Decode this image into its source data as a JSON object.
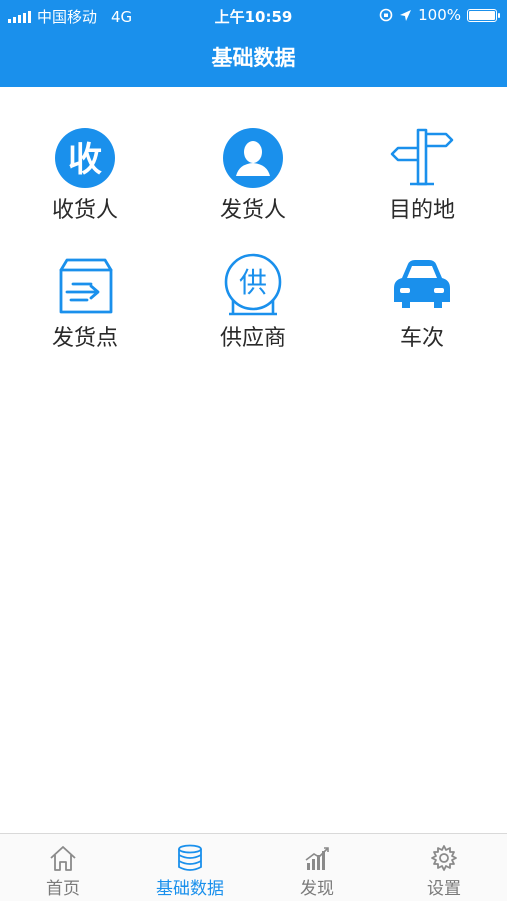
{
  "status": {
    "carrier": "中国移动",
    "network": "4G",
    "time": "上午10:59",
    "battery": "100%"
  },
  "header": {
    "title": "基础数据"
  },
  "grid": {
    "items": [
      {
        "label": "收货人",
        "icon": "receive-icon",
        "glyph": "收"
      },
      {
        "label": "发货人",
        "icon": "person-icon"
      },
      {
        "label": "目的地",
        "icon": "signpost-icon"
      },
      {
        "label": "发货点",
        "icon": "box-arrow-icon"
      },
      {
        "label": "供应商",
        "icon": "supplier-icon",
        "glyph": "供"
      },
      {
        "label": "车次",
        "icon": "car-icon"
      }
    ]
  },
  "tabbar": {
    "tabs": [
      {
        "label": "首页",
        "icon": "home-icon",
        "active": false
      },
      {
        "label": "基础数据",
        "icon": "database-icon",
        "active": true
      },
      {
        "label": "发现",
        "icon": "chart-icon",
        "active": false
      },
      {
        "label": "设置",
        "icon": "gear-icon",
        "active": false
      }
    ]
  },
  "colors": {
    "accent": "#1a90ec",
    "text": "#2a2a2a",
    "tab_inactive": "#7a7a7a"
  }
}
